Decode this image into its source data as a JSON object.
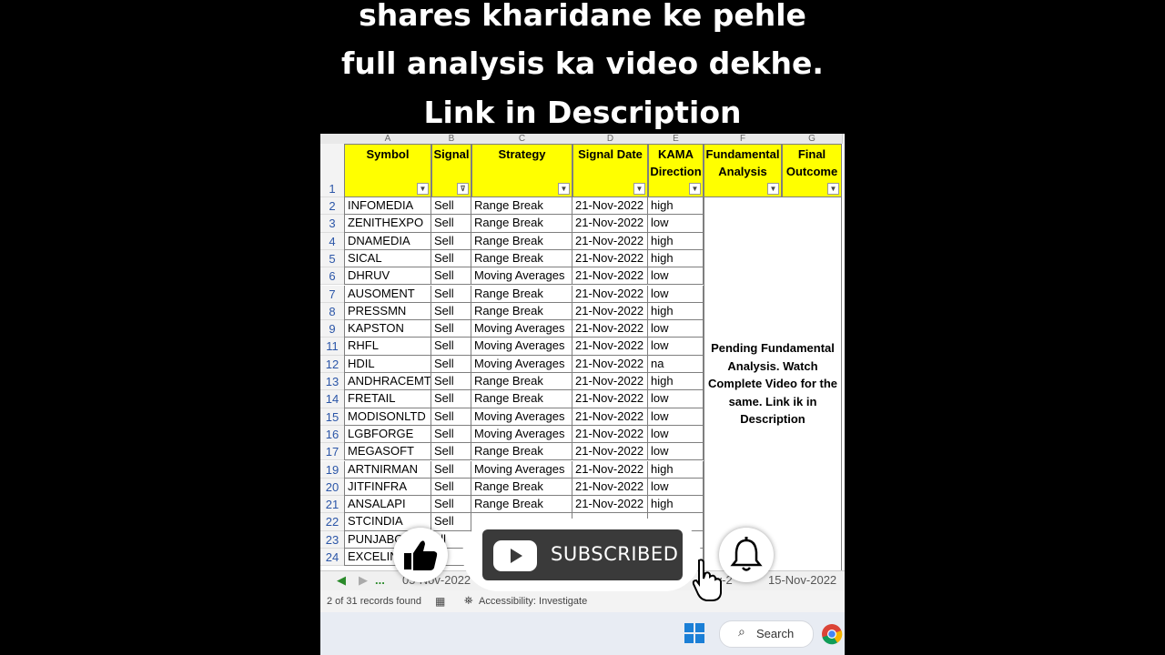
{
  "caption": {
    "line1": "shares kharidane ke pehle",
    "line2": "full analysis ka video dekhe.",
    "line3": "Link in Description"
  },
  "sheet": {
    "column_letters": [
      "A",
      "B",
      "C",
      "D",
      "E",
      "F",
      "G"
    ],
    "header_row_number": "1",
    "headers": {
      "symbol": "Symbol",
      "signal": "Signal",
      "strategy": "Strategy",
      "signal_date": "Signal Date",
      "kama_direction_1": "KAMA",
      "kama_direction_2": "Direction",
      "fundamental_1": "Fundamental",
      "fundamental_2": "Analysis",
      "final_1": "Final",
      "final_2": "Outcome"
    },
    "rows": [
      {
        "n": "2",
        "symbol": "INFOMEDIA",
        "signal": "Sell",
        "strategy": "Range Break",
        "date": "21-Nov-2022",
        "kama": "high"
      },
      {
        "n": "3",
        "symbol": "ZENITHEXPO",
        "signal": "Sell",
        "strategy": "Range Break",
        "date": "21-Nov-2022",
        "kama": "low"
      },
      {
        "n": "4",
        "symbol": "DNAMEDIA",
        "signal": "Sell",
        "strategy": "Range Break",
        "date": "21-Nov-2022",
        "kama": "high"
      },
      {
        "n": "5",
        "symbol": "SICAL",
        "signal": "Sell",
        "strategy": "Range Break",
        "date": "21-Nov-2022",
        "kama": "high"
      },
      {
        "n": "6",
        "symbol": "DHRUV",
        "signal": "Sell",
        "strategy": "Moving Averages",
        "date": "21-Nov-2022",
        "kama": "low"
      },
      {
        "n": "7",
        "symbol": "AUSOMENT",
        "signal": "Sell",
        "strategy": "Range Break",
        "date": "21-Nov-2022",
        "kama": "low"
      },
      {
        "n": "8",
        "symbol": "PRESSMN",
        "signal": "Sell",
        "strategy": "Range Break",
        "date": "21-Nov-2022",
        "kama": "high"
      },
      {
        "n": "9",
        "symbol": "KAPSTON",
        "signal": "Sell",
        "strategy": "Moving Averages",
        "date": "21-Nov-2022",
        "kama": "low"
      },
      {
        "n": "11",
        "symbol": "RHFL",
        "signal": "Sell",
        "strategy": "Moving Averages",
        "date": "21-Nov-2022",
        "kama": "low"
      },
      {
        "n": "12",
        "symbol": "HDIL",
        "signal": "Sell",
        "strategy": "Moving Averages",
        "date": "21-Nov-2022",
        "kama": "na"
      },
      {
        "n": "13",
        "symbol": "ANDHRACEMT",
        "signal": "Sell",
        "strategy": "Range Break",
        "date": "21-Nov-2022",
        "kama": "high"
      },
      {
        "n": "14",
        "symbol": "FRETAIL",
        "signal": "Sell",
        "strategy": "Range Break",
        "date": "21-Nov-2022",
        "kama": "low"
      },
      {
        "n": "15",
        "symbol": "MODISONLTD",
        "signal": "Sell",
        "strategy": "Moving Averages",
        "date": "21-Nov-2022",
        "kama": "low"
      },
      {
        "n": "16",
        "symbol": "LGBFORGE",
        "signal": "Sell",
        "strategy": "Moving Averages",
        "date": "21-Nov-2022",
        "kama": "low"
      },
      {
        "n": "17",
        "symbol": "MEGASOFT",
        "signal": "Sell",
        "strategy": "Range Break",
        "date": "21-Nov-2022",
        "kama": "low"
      },
      {
        "n": "19",
        "symbol": "ARTNIRMAN",
        "signal": "Sell",
        "strategy": "Moving Averages",
        "date": "21-Nov-2022",
        "kama": "high"
      },
      {
        "n": "20",
        "symbol": "JITFINFRA",
        "signal": "Sell",
        "strategy": "Range Break",
        "date": "21-Nov-2022",
        "kama": "low"
      },
      {
        "n": "21",
        "symbol": "ANSALAPI",
        "signal": "Sell",
        "strategy": "Range Break",
        "date": "21-Nov-2022",
        "kama": "high"
      },
      {
        "n": "22",
        "symbol": "STCINDIA",
        "signal": "Sell",
        "strategy": "",
        "date": "",
        "kama": ""
      },
      {
        "n": "23",
        "symbol": "PUNJABC",
        "signal": "ell",
        "strategy": "",
        "date": "",
        "kama": ""
      },
      {
        "n": "24",
        "symbol": "EXCELIN",
        "signal": "ll",
        "strategy": "",
        "date": "",
        "kama": ""
      }
    ],
    "merged_note": "Pending Fundamental Analysis. Watch Complete Video for the same. Link ik in Description"
  },
  "tabs": {
    "ellipsis": "...",
    "left_tab": "05-Nov-2022",
    "mid_tab": "Nov-2",
    "right_tab": "15-Nov-2022"
  },
  "status": {
    "records": "2 of 31 records found",
    "accessibility": "Accessibility: Investigate"
  },
  "taskbar": {
    "search_label": "Search"
  },
  "subscribe": {
    "label": "SUBSCRIBED",
    "accent": "#3a3a3a"
  }
}
